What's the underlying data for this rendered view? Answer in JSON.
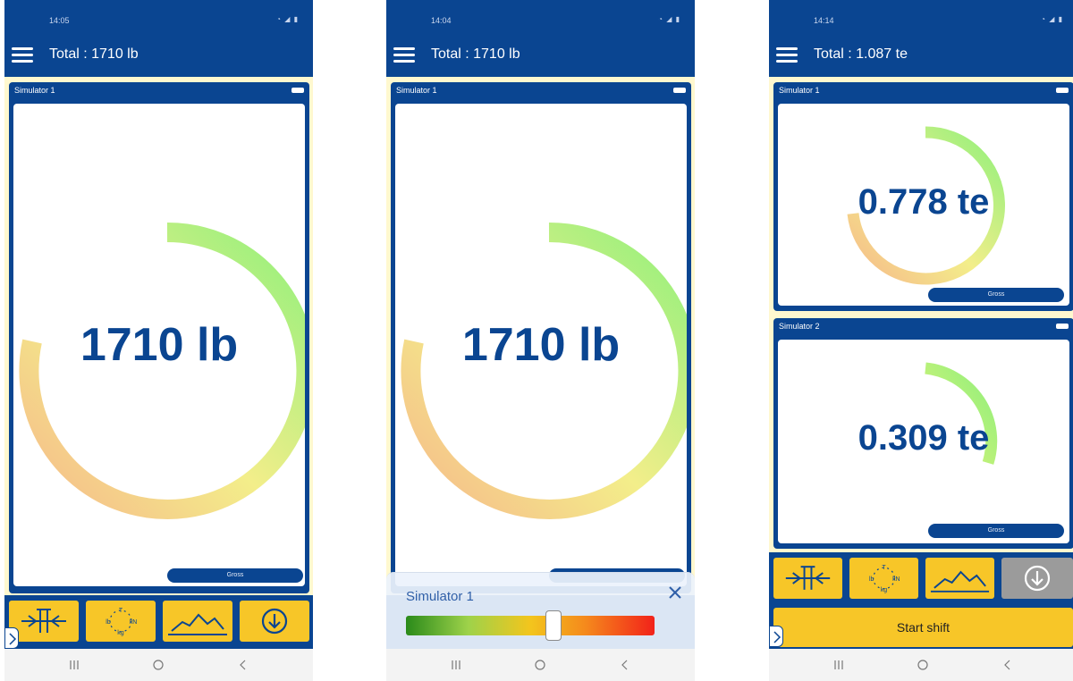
{
  "colors": {
    "brand_blue": "#0a4591",
    "accent_yellow": "#f7c628",
    "gauge_start": "#f6b98a",
    "gauge_end": "#8ef07b"
  },
  "phones": [
    {
      "status_time": "14:05",
      "app_title": "Total : 1710 lb",
      "cards": [
        {
          "title": "Simulator 1",
          "value": "1710 lb",
          "badge": "Gross"
        }
      ],
      "toolbar_icons": [
        "tare-icon",
        "units-icon",
        "graph-icon",
        "download-icon"
      ]
    },
    {
      "status_time": "14:04",
      "app_title": "Total : 1710 lb",
      "cards": [
        {
          "title": "Simulator 1",
          "value": "1710 lb"
        }
      ],
      "sheet": {
        "title": "Simulator 1",
        "slider_level": 0.6
      }
    },
    {
      "status_time": "14:14",
      "app_title": "Total : 1.087 te",
      "cards": [
        {
          "title": "Simulator 1",
          "value": "0.778 te",
          "badge": "Gross"
        },
        {
          "title": "Simulator 2",
          "value": "0.309 te",
          "badge": "Gross"
        }
      ],
      "toolbar_icons": [
        "tare-icon",
        "units-icon",
        "graph-icon",
        "download-icon"
      ],
      "start_shift_label": "Start shift"
    }
  ],
  "unit_labels": {
    "top": "T",
    "left": "lb",
    "right": "kN",
    "bottom": "kg"
  },
  "nav_icons": [
    "recent-apps-icon",
    "home-icon",
    "back-icon"
  ]
}
